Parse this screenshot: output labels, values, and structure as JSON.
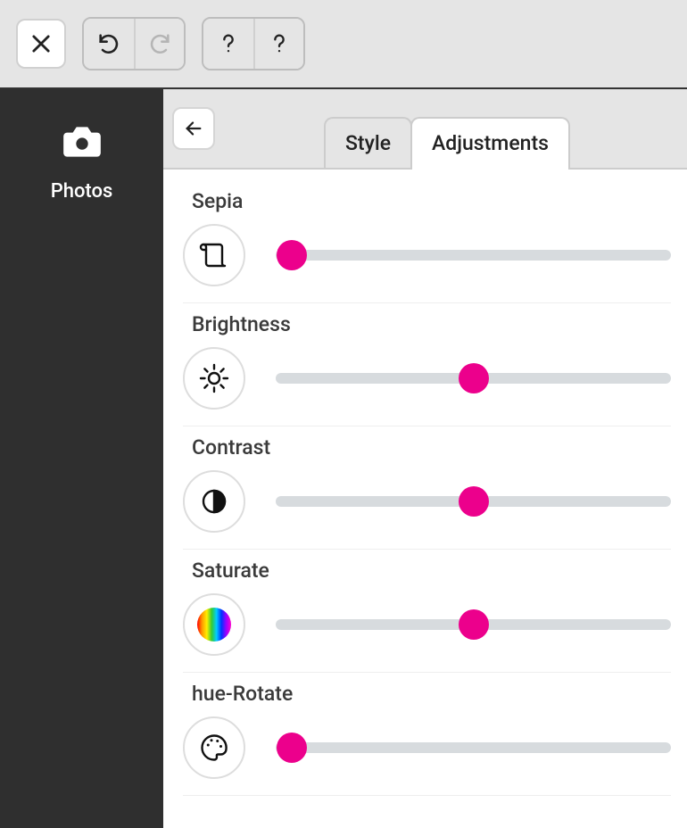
{
  "toolbar": {
    "close": "close",
    "undo": "undo",
    "redo": "redo",
    "help1": "help",
    "help2": "help"
  },
  "sidebar": {
    "photos_label": "Photos"
  },
  "panel": {
    "back": "back",
    "tabs": [
      {
        "label": "Style",
        "active": false
      },
      {
        "label": "Adjustments",
        "active": true
      }
    ]
  },
  "adjustments": [
    {
      "key": "sepia",
      "label": "Sepia",
      "icon": "scroll-icon",
      "value": 4
    },
    {
      "key": "brightness",
      "label": "Brightness",
      "icon": "sun-icon",
      "value": 50
    },
    {
      "key": "contrast",
      "label": "Contrast",
      "icon": "contrast-icon",
      "value": 50
    },
    {
      "key": "saturate",
      "label": "Saturate",
      "icon": "rainbow-icon",
      "value": 50
    },
    {
      "key": "hueRotate",
      "label": "hue-Rotate",
      "icon": "palette-icon",
      "value": 4
    }
  ],
  "accent": "#ec008c"
}
